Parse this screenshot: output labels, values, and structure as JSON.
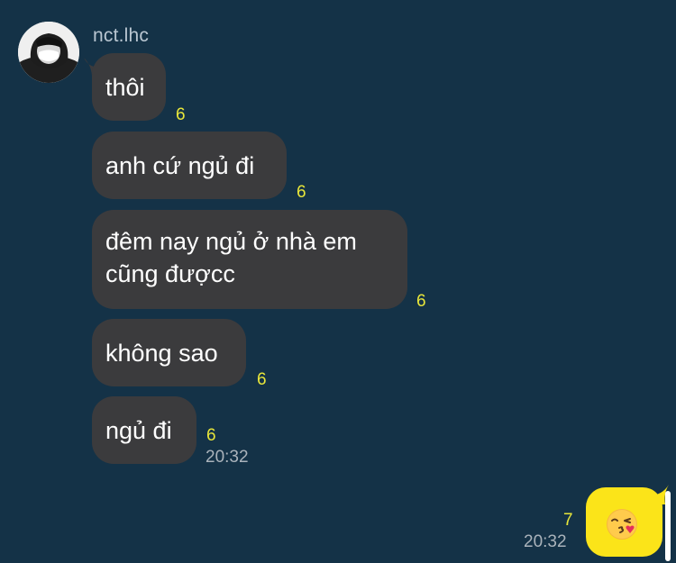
{
  "chat": {
    "background_color": "#143247",
    "sender": {
      "name": "nct.lhc",
      "avatar": "avatar-photo"
    },
    "incoming_messages": [
      {
        "text_lines": [
          "thôi"
        ],
        "unread": "6"
      },
      {
        "text_lines": [
          "anh cứ ngủ đi"
        ],
        "unread": "6"
      },
      {
        "text_lines": [
          "đêm nay ngủ ở nhà em",
          "cũng đượcc"
        ],
        "unread": "6"
      },
      {
        "text_lines": [
          "không sao"
        ],
        "unread": "6"
      },
      {
        "text_lines": [
          "ngủ đi"
        ],
        "unread": "6",
        "time": "20:32"
      }
    ],
    "outgoing_message": {
      "emoji": "face-blowing-a-kiss",
      "unread": "7",
      "time": "20:32",
      "bubble_color": "#fbe419"
    },
    "colors": {
      "incoming_bubble": "#3b3b3d",
      "unread_count": "#e8e63a",
      "timestamp": "#aab3bb"
    }
  }
}
